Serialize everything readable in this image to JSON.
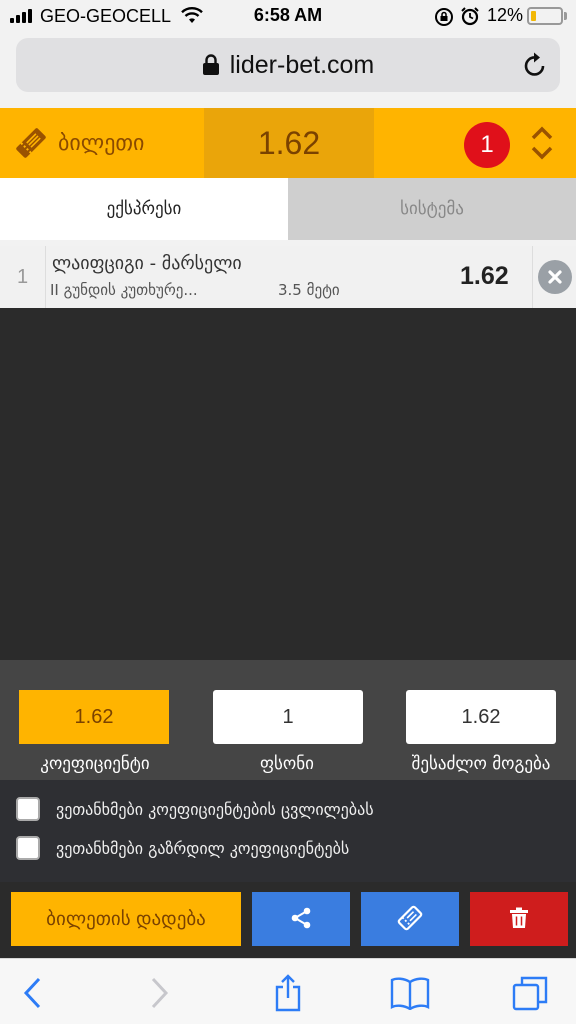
{
  "status_bar": {
    "carrier": "GEO-GEOCELL",
    "time": "6:58 AM",
    "battery": "12%"
  },
  "browser": {
    "url": "lider-bet.com"
  },
  "ticket": {
    "title": "ბილეთი",
    "total_odds": "1.62",
    "selection_count": "1"
  },
  "tabs": [
    {
      "label": "ექსპრესი",
      "active": true
    },
    {
      "label": "სისტემა",
      "active": false
    }
  ],
  "bets": [
    {
      "number": "1",
      "match": "ლაიფციგი - მარსელი",
      "market": "II გუნდის კუთხურე...",
      "outcome": "3.5 მეტი",
      "odds": "1.62"
    }
  ],
  "amounts": {
    "odds_value": "1.62",
    "odds_label": "კოეფიციენტი",
    "stake_value": "1",
    "stake_label": "ფსონი",
    "win_value": "1.62",
    "win_label": "შესაძლო მოგება"
  },
  "options": [
    {
      "label": "ვეთანხმები კოეფიციენტების ცვლილებას",
      "checked": false
    },
    {
      "label": "ვეთანხმები გაზრდილ კოეფიციენტებს",
      "checked": false
    }
  ],
  "actions": {
    "place_bet": "ბილეთის დადება"
  },
  "colors": {
    "accent": "#ffb400",
    "blue": "#3a7de0",
    "red": "#cf1d1d",
    "badge": "#e0101a"
  }
}
